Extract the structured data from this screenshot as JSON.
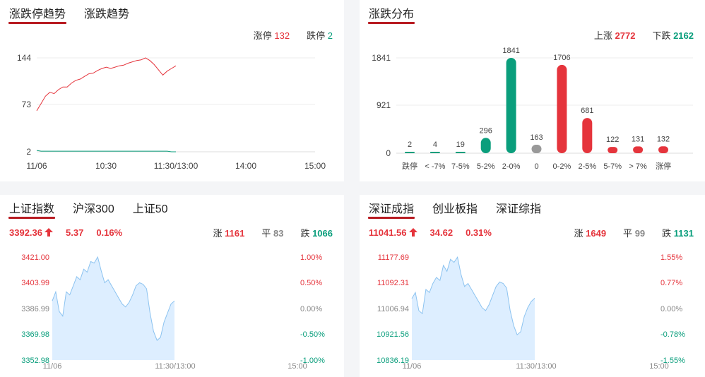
{
  "limit_panel": {
    "tabs": [
      "涨跌停趋势",
      "涨跌趋势"
    ],
    "stats": {
      "up_label": "涨停",
      "up_value": "132",
      "down_label": "跌停",
      "down_value": "2"
    },
    "y_ticks": [
      "144",
      "73",
      "2"
    ],
    "x_ticks": [
      "11/06",
      "10:30",
      "11:30/13:00",
      "14:00",
      "15:00"
    ]
  },
  "dist_panel": {
    "tabs": [
      "涨跌分布"
    ],
    "stats": {
      "up_label": "上涨",
      "up_value": "2772",
      "down_label": "下跌",
      "down_value": "2162"
    },
    "y_ticks": [
      "1841",
      "921",
      "0"
    ]
  },
  "sh_panel": {
    "tabs": [
      "上证指数",
      "沪深300",
      "上证50"
    ],
    "price": "3392.36",
    "change": "5.37",
    "pct": "0.16%",
    "breadth": {
      "up_label": "涨",
      "up_value": "1161",
      "flat_label": "平",
      "flat_value": "83",
      "down_label": "跌",
      "down_value": "1066"
    },
    "y_left": [
      "3421.00",
      "3403.99",
      "3386.99",
      "3369.98",
      "3352.98"
    ],
    "y_right": [
      "1.00%",
      "0.50%",
      "0.00%",
      "-0.50%",
      "-1.00%"
    ],
    "x_ticks": [
      "11/06",
      "11:30/13:00",
      "15:00"
    ]
  },
  "sz_panel": {
    "tabs": [
      "深证成指",
      "创业板指",
      "深证综指"
    ],
    "price": "11041.56",
    "change": "34.62",
    "pct": "0.31%",
    "breadth": {
      "up_label": "涨",
      "up_value": "1649",
      "flat_label": "平",
      "flat_value": "99",
      "down_label": "跌",
      "down_value": "1131"
    },
    "y_left": [
      "11177.69",
      "11092.31",
      "11006.94",
      "10921.56",
      "10836.19"
    ],
    "y_right": [
      "1.55%",
      "0.77%",
      "0.00%",
      "-0.78%",
      "-1.55%"
    ],
    "x_ticks": [
      "11/06",
      "11:30/13:00",
      "15:00"
    ]
  },
  "colors": {
    "up": "#e5343c",
    "down": "#0a9e7c",
    "flat": "#999999",
    "area": "#ddeeff",
    "area_line": "#8cc3f0",
    "tab_underline": "#b81c22"
  },
  "chart_data": [
    {
      "type": "line",
      "x_ticks": [
        "11/06",
        "10:30",
        "11:30/13:00",
        "14:00",
        "15:00"
      ],
      "ylim": [
        2,
        144
      ],
      "series": [
        {
          "name": "涨停",
          "values": [
            64,
            75,
            86,
            92,
            90,
            96,
            100,
            100,
            106,
            110,
            112,
            116,
            120,
            121,
            125,
            128,
            130,
            128,
            130,
            132,
            133,
            136,
            138,
            140,
            141,
            144,
            140,
            134,
            126,
            118,
            124,
            128,
            132
          ],
          "color": "#e5343c"
        },
        {
          "name": "跌停",
          "values": [
            4,
            3,
            3,
            3,
            3,
            3,
            3,
            3,
            3,
            3,
            3,
            3,
            3,
            3,
            3,
            3,
            3,
            3,
            3,
            3,
            3,
            3,
            3,
            3,
            3,
            3,
            3,
            3,
            3,
            3,
            3,
            2,
            2
          ],
          "color": "#0a9e7c"
        }
      ]
    },
    {
      "type": "bar",
      "categories": [
        "跌停",
        "< -7%",
        "7-5%",
        "5-2%",
        "2-0%",
        "0",
        "0-2%",
        "2-5%",
        "5-7%",
        "> 7%",
        "涨停"
      ],
      "values": [
        2,
        4,
        19,
        296,
        1841,
        163,
        1706,
        681,
        122,
        131,
        132
      ],
      "colors": [
        "#0a9e7c",
        "#0a9e7c",
        "#0a9e7c",
        "#0a9e7c",
        "#0a9e7c",
        "#999999",
        "#e5343c",
        "#e5343c",
        "#e5343c",
        "#e5343c",
        "#e5343c"
      ],
      "ylim": [
        0,
        1841
      ]
    },
    {
      "type": "area",
      "ylim": [
        3352.98,
        3421.0
      ],
      "values": [
        3392,
        3398,
        3385,
        3382,
        3398,
        3396,
        3402,
        3408,
        3406,
        3413,
        3411,
        3418,
        3417,
        3421,
        3412,
        3404,
        3406,
        3402,
        3398,
        3394,
        3390,
        3388,
        3391,
        3396,
        3402,
        3404,
        3403,
        3400,
        3384,
        3372,
        3366,
        3368,
        3378,
        3384,
        3390,
        3392
      ]
    },
    {
      "type": "area",
      "ylim": [
        10836.19,
        11177.69
      ],
      "values": [
        11040,
        11060,
        11000,
        10990,
        11070,
        11060,
        11090,
        11110,
        11100,
        11150,
        11130,
        11170,
        11160,
        11177,
        11120,
        11080,
        11090,
        11070,
        11050,
        11030,
        11010,
        11000,
        11020,
        11050,
        11080,
        11095,
        11090,
        11075,
        11000,
        10950,
        10920,
        10930,
        10980,
        11010,
        11030,
        11041
      ]
    }
  ]
}
